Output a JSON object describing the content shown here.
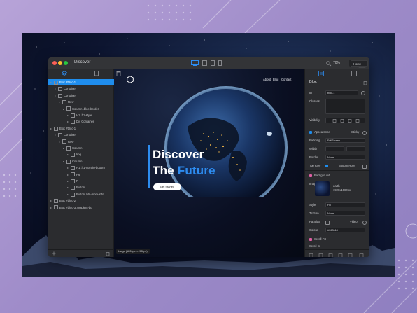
{
  "window": {
    "title": "Discover",
    "zoom": "70%",
    "page_selector": "Home"
  },
  "left_panel": {
    "tree": [
      {
        "label": "Bloc #bloc-1",
        "depth": 0,
        "selected": true
      },
      {
        "label": "Container",
        "depth": 1
      },
      {
        "label": "Container",
        "depth": 1
      },
      {
        "label": "Row",
        "depth": 2
      },
      {
        "label": "Column .blue-border",
        "depth": 3
      },
      {
        "label": "H1 .h1-style",
        "depth": 4
      },
      {
        "label": "Div Container",
        "depth": 4
      },
      {
        "label": "Bloc #bloc-1",
        "depth": 0
      },
      {
        "label": "Container",
        "depth": 1
      },
      {
        "label": "Row",
        "depth": 2
      },
      {
        "label": "Column",
        "depth": 3
      },
      {
        "label": "Img",
        "depth": 4
      },
      {
        "label": "Column",
        "depth": 3
      },
      {
        "label": "H1 .h1-margin-bottom",
        "depth": 4
      },
      {
        "label": "H6",
        "depth": 4
      },
      {
        "label": "P",
        "depth": 4
      },
      {
        "label": "Button",
        "depth": 4
      },
      {
        "label": "Button .btn-more-info...",
        "depth": 4
      },
      {
        "label": "Bloc #bloc-2",
        "depth": 0
      },
      {
        "label": "Bloc #bloc-3 .gradient-bg",
        "depth": 0
      }
    ]
  },
  "canvas": {
    "nav": [
      "About",
      "Blog",
      "Contact"
    ],
    "hero_line1": "Discover",
    "hero_line2_prefix": "The ",
    "hero_line2_accent": "Future",
    "cta_label": "Get Started",
    "size_label": "Large (1200px -> 992px)"
  },
  "right_panel": {
    "header": "Bloc",
    "id_label": "ID",
    "id_value": "bloc-1",
    "classes_label": "Classes",
    "visibility_label": "Visibility",
    "appearance_label": "Appearance",
    "sticky_label": "Sticky",
    "padding_label": "Padding",
    "padding_value": "FullScreen",
    "width_label": "Width",
    "border_label": "Border",
    "border_value": "None",
    "toprow_label": "Top Row",
    "bottomrow_label": "Bottom Row",
    "background_label": "Background",
    "image_label": "Image",
    "image_name": "earth",
    "image_size": "1920x1080px",
    "style_label": "Style",
    "style_value": "Fill",
    "texture_label": "Texture",
    "texture_value": "None",
    "parallax_label": "Parallax",
    "video_label": "Video",
    "colour_label": "Colour",
    "colour_value": "#060b18",
    "scrollfx_label": "Scroll FX",
    "scrollin_label": "Scroll In",
    "accent_color": "#1f8ded"
  }
}
